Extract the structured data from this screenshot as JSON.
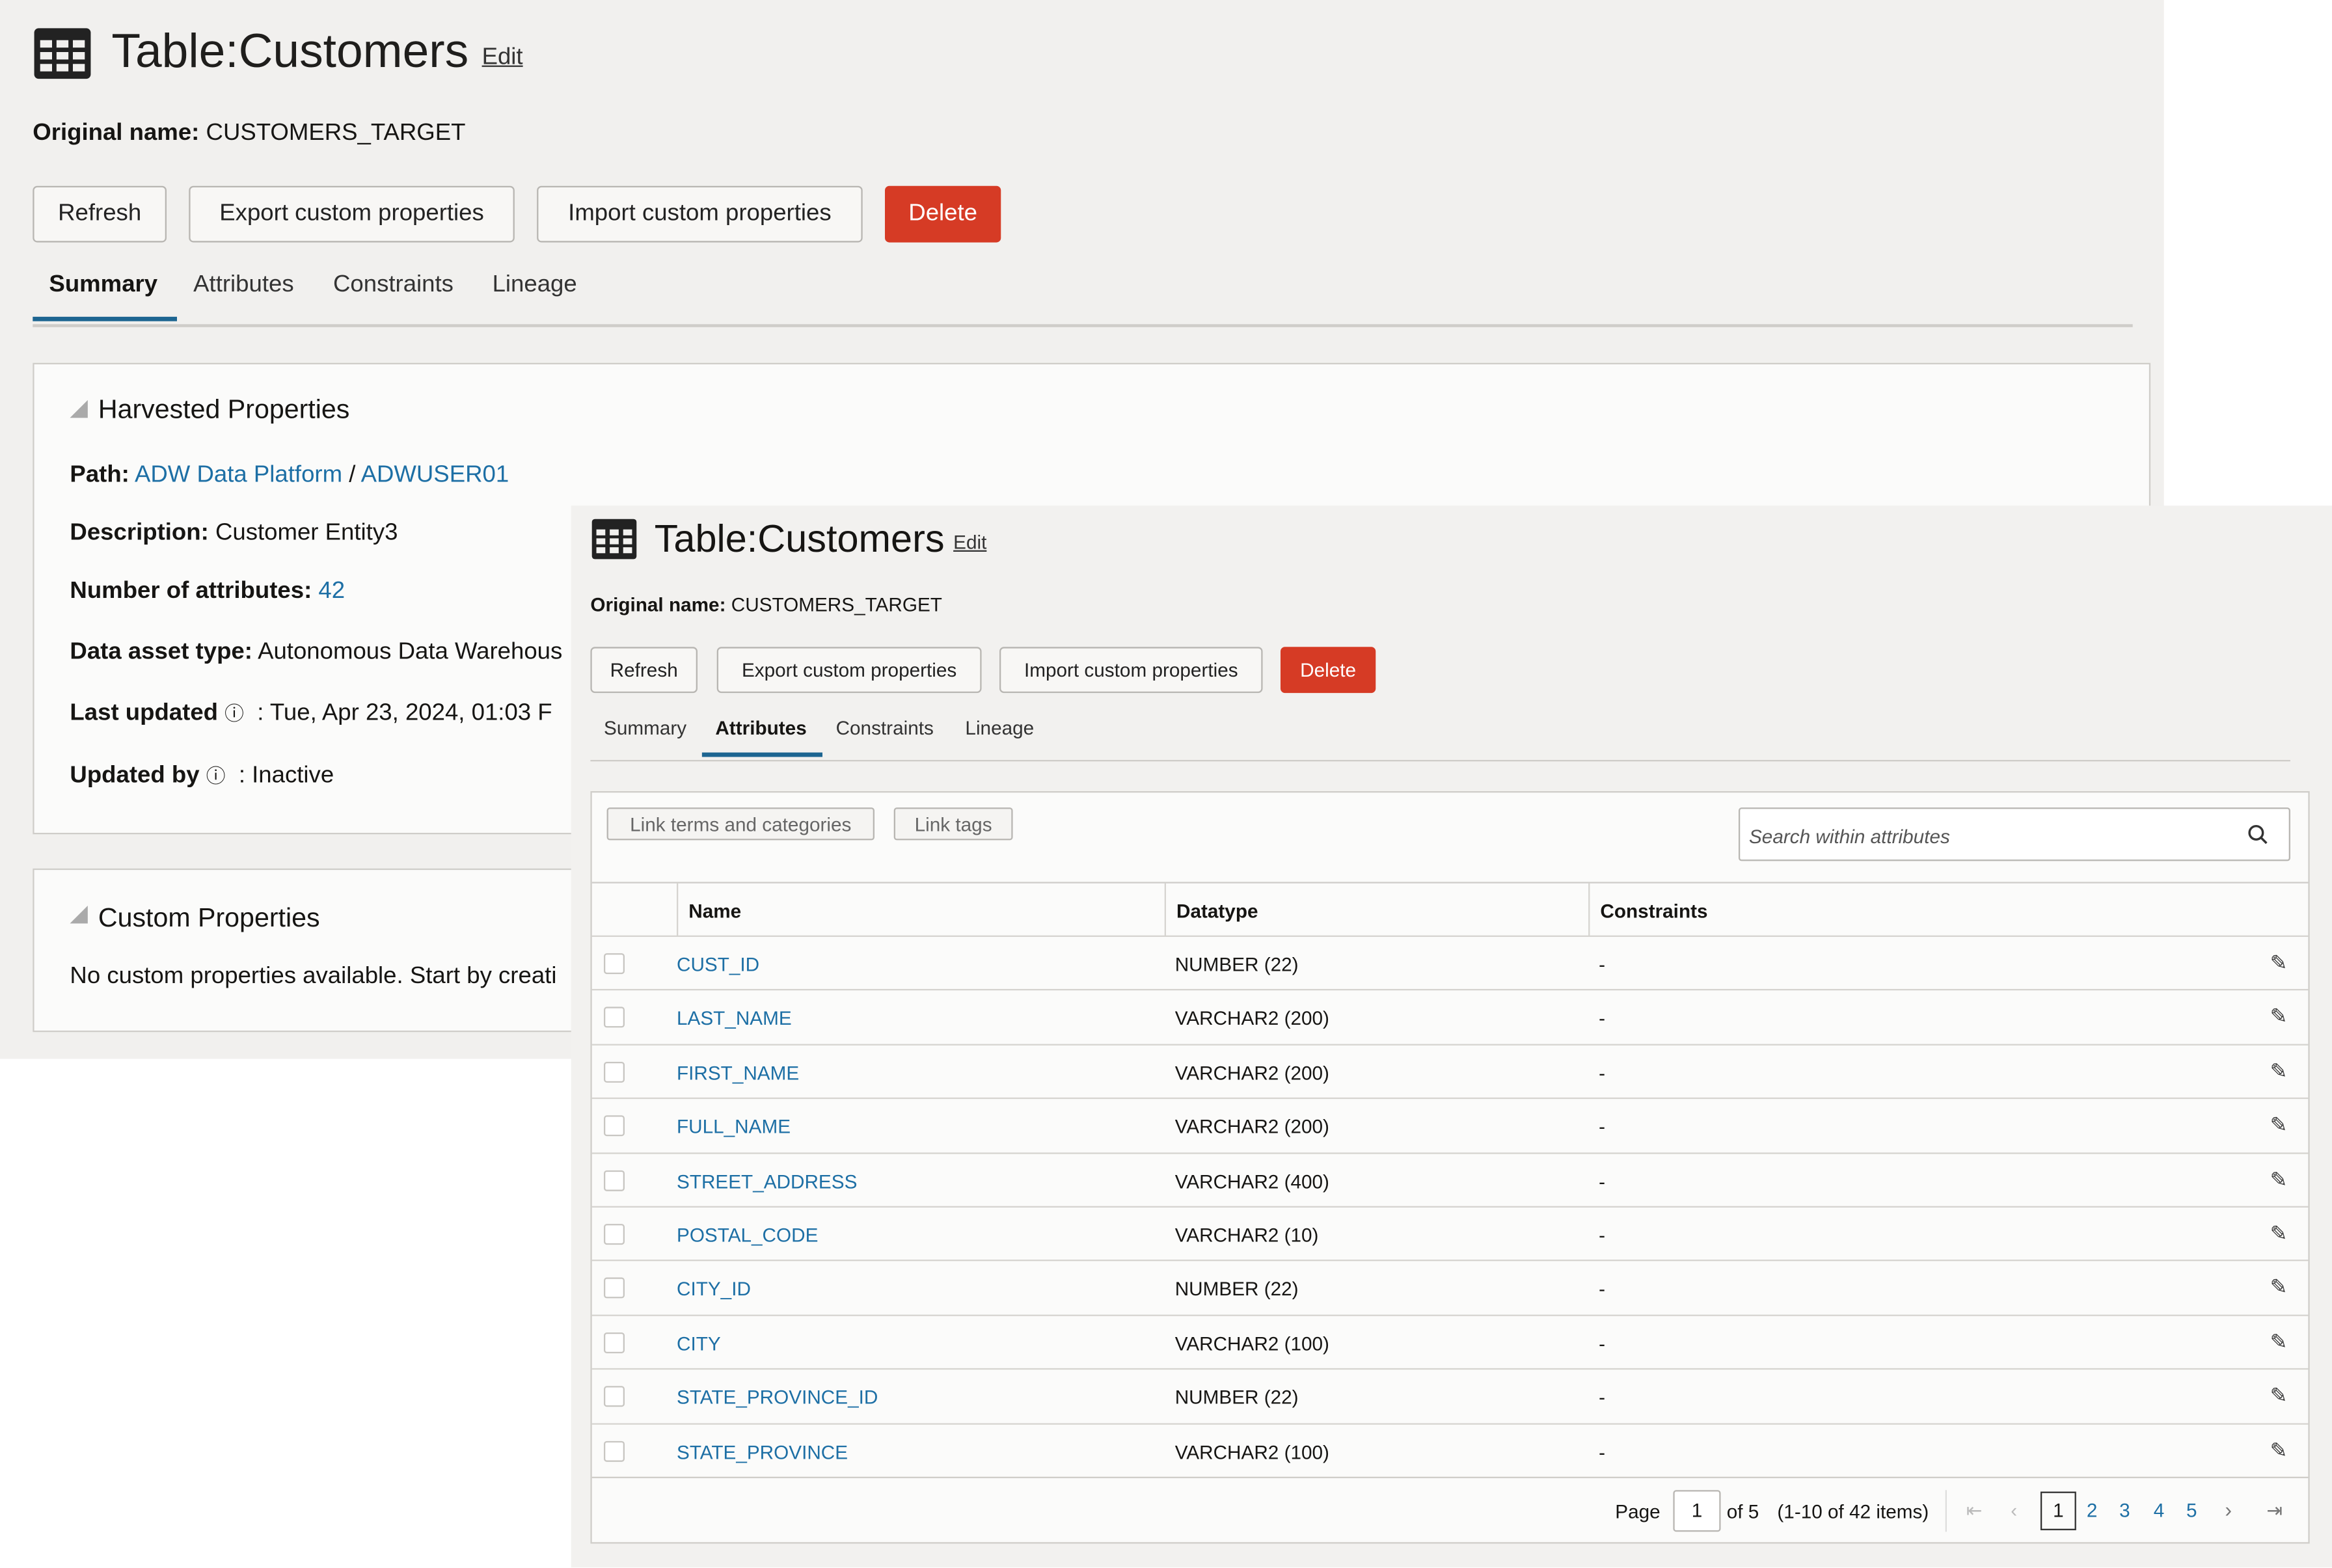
{
  "back": {
    "title": "Table:Customers",
    "edit": "Edit",
    "original_label": "Original name:",
    "original_value": "CUSTOMERS_TARGET",
    "buttons": {
      "refresh": "Refresh",
      "export": "Export custom properties",
      "import": "Import custom properties",
      "delete": "Delete"
    },
    "tabs": [
      "Summary",
      "Attributes",
      "Constraints",
      "Lineage"
    ],
    "harvested": {
      "heading": "Harvested Properties",
      "path_label": "Path:",
      "path_1": "ADW Data Platform",
      "path_sep": "/",
      "path_2": "ADWUSER01",
      "desc_label": "Description:",
      "desc_value": "Customer Entity3",
      "num_label": "Number of attributes:",
      "num_value": "42",
      "type_label": "Data asset type:",
      "type_value": "Autonomous Data Warehous",
      "updated_label": "Last updated",
      "updated_value": ": Tue, Apr 23, 2024, 01:03 F",
      "by_label": "Updated by",
      "by_value": ": Inactive"
    },
    "custom": {
      "heading": "Custom Properties",
      "text": "No custom properties available. Start by creati"
    }
  },
  "front": {
    "title": "Table:Customers",
    "edit": "Edit",
    "original_label": "Original name:",
    "original_value": "CUSTOMERS_TARGET",
    "buttons": {
      "refresh": "Refresh",
      "export": "Export custom properties",
      "import": "Import custom properties",
      "delete": "Delete"
    },
    "tabs": [
      "Summary",
      "Attributes",
      "Constraints",
      "Lineage"
    ],
    "toolbar": {
      "link_terms": "Link terms and categories",
      "link_tags": "Link tags",
      "search_placeholder": "Search within attributes"
    },
    "columns": [
      "Name",
      "Datatype",
      "Constraints"
    ],
    "rows": [
      {
        "name": "CUST_ID",
        "type": "NUMBER (22)",
        "c": "-"
      },
      {
        "name": "LAST_NAME",
        "type": "VARCHAR2 (200)",
        "c": "-"
      },
      {
        "name": "FIRST_NAME",
        "type": "VARCHAR2 (200)",
        "c": "-"
      },
      {
        "name": "FULL_NAME",
        "type": "VARCHAR2 (200)",
        "c": "-"
      },
      {
        "name": "STREET_ADDRESS",
        "type": "VARCHAR2 (400)",
        "c": "-"
      },
      {
        "name": "POSTAL_CODE",
        "type": "VARCHAR2 (10)",
        "c": "-"
      },
      {
        "name": "CITY_ID",
        "type": "NUMBER (22)",
        "c": "-"
      },
      {
        "name": "CITY",
        "type": "VARCHAR2 (100)",
        "c": "-"
      },
      {
        "name": "STATE_PROVINCE_ID",
        "type": "NUMBER (22)",
        "c": "-"
      },
      {
        "name": "STATE_PROVINCE",
        "type": "VARCHAR2 (100)",
        "c": "-"
      }
    ],
    "pagination": {
      "page_label": "Page",
      "page_value": "1",
      "of": "of 5",
      "items": "(1-10 of 42 items)",
      "pages": [
        "1",
        "2",
        "3",
        "4",
        "5"
      ]
    }
  }
}
